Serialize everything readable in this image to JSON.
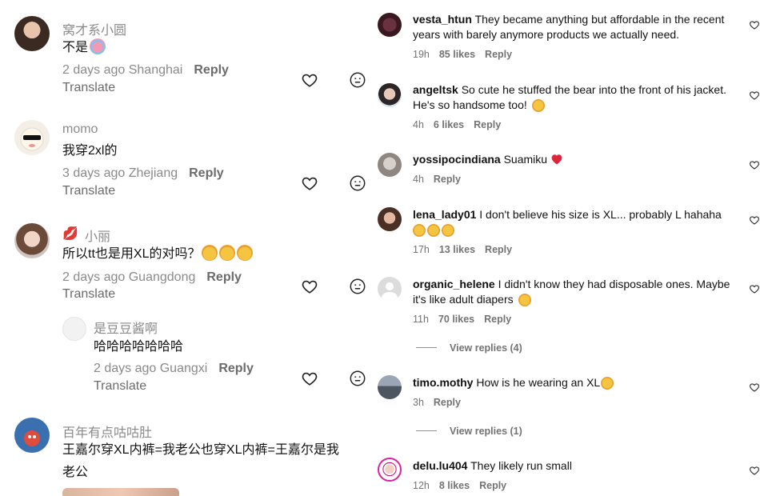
{
  "left_comments": [
    {
      "username": "窝才系小圆",
      "text": "不是",
      "time": "2 days ago",
      "location": "Shanghai",
      "reply_label": "Reply",
      "translate_label": "Translate"
    },
    {
      "username": "momo",
      "text": "我穿2xl的",
      "time": "3 days ago",
      "location": "Zhejiang",
      "reply_label": "Reply",
      "translate_label": "Translate"
    },
    {
      "username": "小丽",
      "text": "所以tt也是用XL的对吗？",
      "time": "2 days ago",
      "location": "Guangdong",
      "reply_label": "Reply",
      "translate_label": "Translate"
    },
    {
      "username": "是豆豆酱啊",
      "text": "哈哈哈哈哈哈哈",
      "time": "2 days ago",
      "location": "Guangxi",
      "reply_label": "Reply",
      "translate_label": "Translate"
    },
    {
      "username": "百年有点咕咕肚",
      "text_line1": "王嘉尔穿XL内裤=我老公也穿XL内裤=王嘉尔是我",
      "text_line2": "老公"
    }
  ],
  "right_comments": [
    {
      "username": "vesta_htun",
      "text": "They became anything but affordable in the recent years with barely anymore products we actually need.",
      "time": "19h",
      "likes": "85 likes",
      "reply_label": "Reply"
    },
    {
      "username": "angeltsk",
      "text": "So cute he stuffed the bear into the front of his jacket. He's so handsome too!",
      "time": "4h",
      "likes": "6 likes",
      "reply_label": "Reply"
    },
    {
      "username": "yossipocindiana",
      "text": "Suamiku",
      "time": "4h",
      "reply_label": "Reply"
    },
    {
      "username": "lena_lady01",
      "text": "I don't believe his size is XL... probably L hahaha",
      "time": "17h",
      "likes": "13 likes",
      "reply_label": "Reply"
    },
    {
      "username": "organic_helene",
      "text": "I didn't know they had disposable ones. Maybe it's like adult diapers",
      "time": "11h",
      "likes": "70 likes",
      "reply_label": "Reply",
      "view_replies": "View replies (4)"
    },
    {
      "username": "timo.mothy",
      "text": "How is he wearing an XL",
      "time": "3h",
      "reply_label": "Reply",
      "view_replies": "View replies (1)"
    },
    {
      "username": "delu.lu404",
      "text": "They likely run small",
      "time": "12h",
      "likes": "8 likes",
      "reply_label": "Reply"
    }
  ],
  "icons": {
    "heart": "heart-outline-icon",
    "face": "emoji-face-icon"
  },
  "colors": {
    "muted_text": "#8a8a8a",
    "emoji_yellow": "#f5c542",
    "red_heart": "#e0243b"
  }
}
